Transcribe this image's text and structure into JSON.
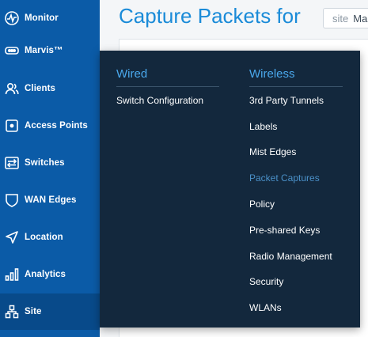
{
  "sidebar": {
    "items": [
      {
        "label": "Monitor",
        "icon": "monitor-icon"
      },
      {
        "label": "Marvis™",
        "icon": "marvis-icon"
      },
      {
        "label": "Clients",
        "icon": "clients-icon"
      },
      {
        "label": "Access Points",
        "icon": "access-point-icon"
      },
      {
        "label": "Switches",
        "icon": "switch-icon"
      },
      {
        "label": "WAN Edges",
        "icon": "wan-edge-icon"
      },
      {
        "label": "Location",
        "icon": "location-icon"
      },
      {
        "label": "Analytics",
        "icon": "analytics-icon"
      },
      {
        "label": "Site",
        "icon": "site-icon"
      }
    ],
    "active": "Site"
  },
  "main": {
    "title": "Capture Packets for",
    "site_select": {
      "prefix": "site",
      "value": "Ma"
    }
  },
  "flyout": {
    "wired": {
      "heading": "Wired",
      "items": [
        "Switch Configuration"
      ]
    },
    "wireless": {
      "heading": "Wireless",
      "items": [
        "3rd Party Tunnels",
        "Labels",
        "Mist Edges",
        "Packet Captures",
        "Policy",
        "Pre-shared Keys",
        "Radio Management",
        "Security",
        "WLANs"
      ],
      "selected": "Packet Captures"
    }
  },
  "colors": {
    "sidebar_bg": "#0b5ba7",
    "flyout_bg": "#13283d",
    "accent": "#1a8bd8",
    "selected_item": "#4a90c8"
  }
}
